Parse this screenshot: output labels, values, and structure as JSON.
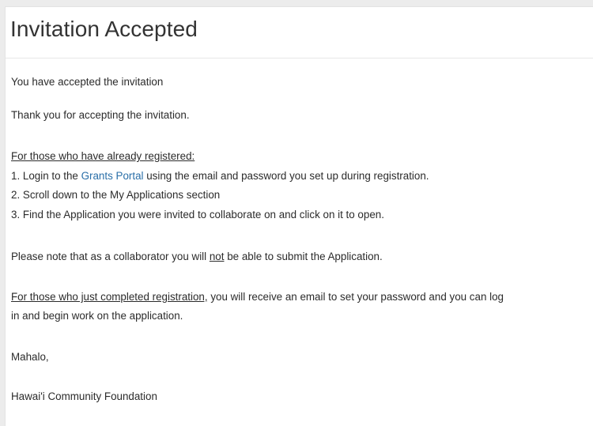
{
  "page": {
    "title": "Invitation Accepted"
  },
  "message": {
    "accepted_line": "You have accepted the invitation",
    "thank_you": "Thank you for accepting the invitation.",
    "registered_heading": "For those who have already registered:",
    "step1_prefix": "1. Login to the ",
    "step1_link": "Grants Portal",
    "step1_suffix": " using the email and password you set up during registration.",
    "step2": "2. Scroll down to the My Applications section",
    "step3": "3. Find the Application you were invited to collaborate on and click on it to open.",
    "note_prefix": "Please note that as a collaborator you will ",
    "note_emphasis": "not",
    "note_suffix": " be able to submit the Application.",
    "new_user_heading": "For those who just completed registration,",
    "new_user_text": " you will receive an email to set your password and you can log",
    "new_user_text2": "in and begin work on the application.",
    "closing": "Mahalo,",
    "signature": "Hawai'i Community Foundation"
  },
  "colors": {
    "link": "#2a6fa8",
    "background": "#ececec",
    "panel": "#ffffff"
  }
}
